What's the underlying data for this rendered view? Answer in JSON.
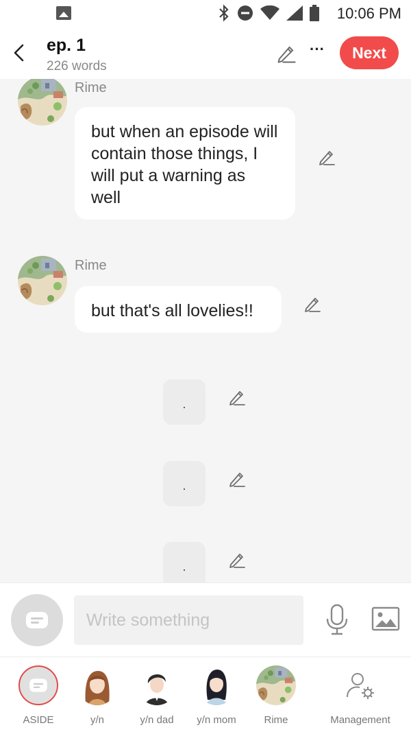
{
  "status_bar": {
    "time": "10:06 PM"
  },
  "header": {
    "title": "ep. 1",
    "subtitle": "226 words",
    "next_label": "Next",
    "more_label": "···"
  },
  "messages": [
    {
      "sender": "Rime",
      "text": "but when an episode will contain those things, I will put a warning as well"
    },
    {
      "sender": "Rime",
      "text": "but that's all lovelies!!"
    },
    {
      "text": "."
    },
    {
      "text": "."
    },
    {
      "text": "."
    }
  ],
  "input": {
    "placeholder": "Write something"
  },
  "characters": [
    {
      "label": "ASIDE",
      "icon": "aside-icon"
    },
    {
      "label": "y/n",
      "icon": "female-avatar"
    },
    {
      "label": "y/n dad",
      "icon": "male-avatar"
    },
    {
      "label": "y/n mom",
      "icon": "female-avatar"
    },
    {
      "label": "Rime",
      "icon": "scene-avatar"
    },
    {
      "label": "Management",
      "icon": "user-gear-icon"
    }
  ],
  "colors": {
    "accent": "#f24b4b",
    "background": "#f5f5f5"
  }
}
